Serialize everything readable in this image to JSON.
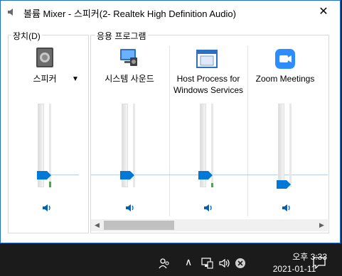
{
  "window": {
    "title": "볼륨 Mixer - 스피커(2- Realtek High Definition Audio)",
    "close_glyph": "✕"
  },
  "device_section": {
    "label": "장치(D)",
    "device": {
      "name": "스피커",
      "icon": "speaker-device-icon",
      "level_percent": 1,
      "meter_active": true
    }
  },
  "apps_section": {
    "label": "응용 프로그램",
    "apps": [
      {
        "name": "시스템 사운드",
        "icon": "system-sounds-icon",
        "level_percent": 1,
        "meter_active": false
      },
      {
        "name_line1": "Host Process for",
        "name_line2": "Windows Services",
        "icon": "host-process-icon",
        "level_percent": 1,
        "meter_active": true
      },
      {
        "name": "Zoom Meetings",
        "icon": "zoom-icon",
        "level_percent": 0,
        "meter_active": false
      }
    ]
  },
  "taskbar": {
    "time": "오후 3:33",
    "date": "2021-01-11",
    "icons": [
      "people-icon",
      "chevron-up-icon",
      "network-icon",
      "volume-icon",
      "close-circle-icon",
      "notification-icon"
    ]
  },
  "colors": {
    "accent": "#0078d7",
    "window_border": "#1f6fd0",
    "taskbar": "#1b1b1b"
  }
}
